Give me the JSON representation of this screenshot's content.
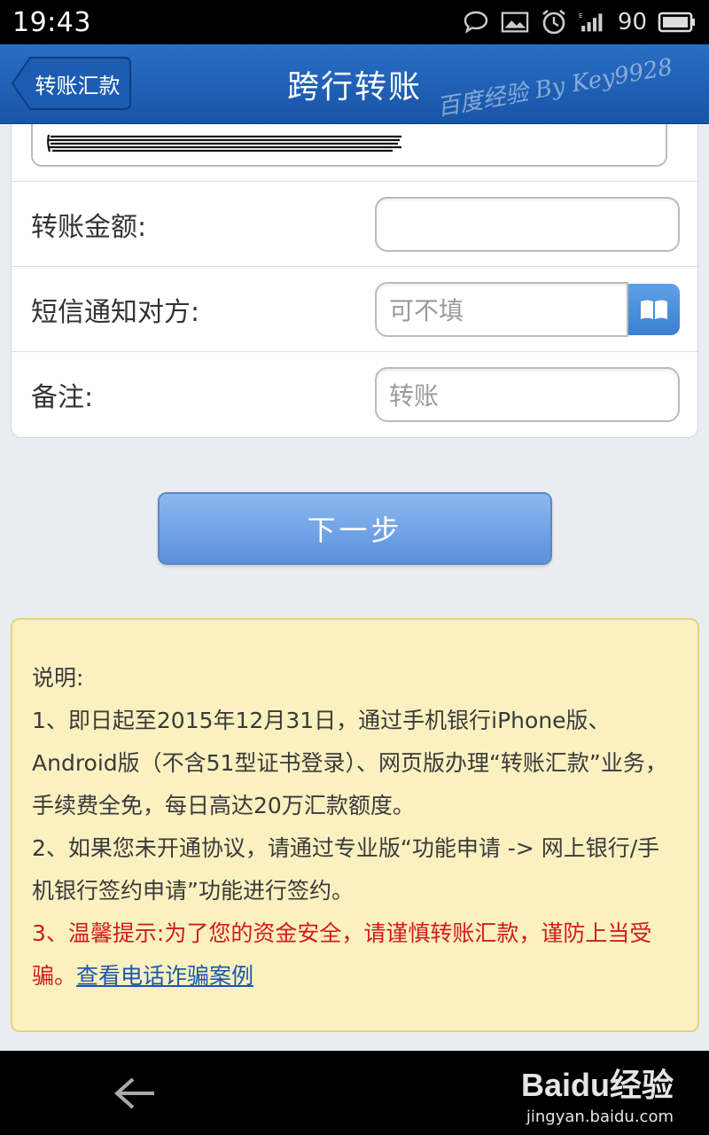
{
  "status_bar": {
    "time": "19:43",
    "battery": "90",
    "icons": [
      "chat-icon",
      "image-icon",
      "alarm-icon",
      "signal-icon",
      "battery-icon"
    ]
  },
  "header": {
    "back_label": "转账汇款",
    "title": "跨行转账",
    "watermark": "百度经验 By Key9928"
  },
  "form": {
    "amount_label": "转账金额:",
    "amount_value": "",
    "sms_label": "短信通知对方:",
    "sms_placeholder": "可不填",
    "note_label": "备注:",
    "note_placeholder": "转账"
  },
  "next_button": "下一步",
  "notice": {
    "title": "说明:",
    "item1": "1、即日起至2015年12月31日，通过手机银行iPhone版、Android版（不含51型证书登录）、网页版办理“转账汇款”业务，手续费全免，每日高达20万汇款额度。",
    "item2": "2、如果您未开通协议，请通过专业版“功能申请 -> 网上银行/手机银行签约申请”功能进行签约。",
    "item3": "3、温馨提示:为了您的资金安全，请谨慎转账汇款，谨防上当受骗。",
    "link": "查看电话诈骗案例"
  },
  "nav": {
    "brand": "Baidu经验",
    "url": "jingyan.baidu.com"
  },
  "colors": {
    "header_blue": "#1f62b8",
    "button_blue": "#6a9fe3",
    "notice_bg": "#fbf1c0",
    "warn_red": "#d31b1b"
  }
}
